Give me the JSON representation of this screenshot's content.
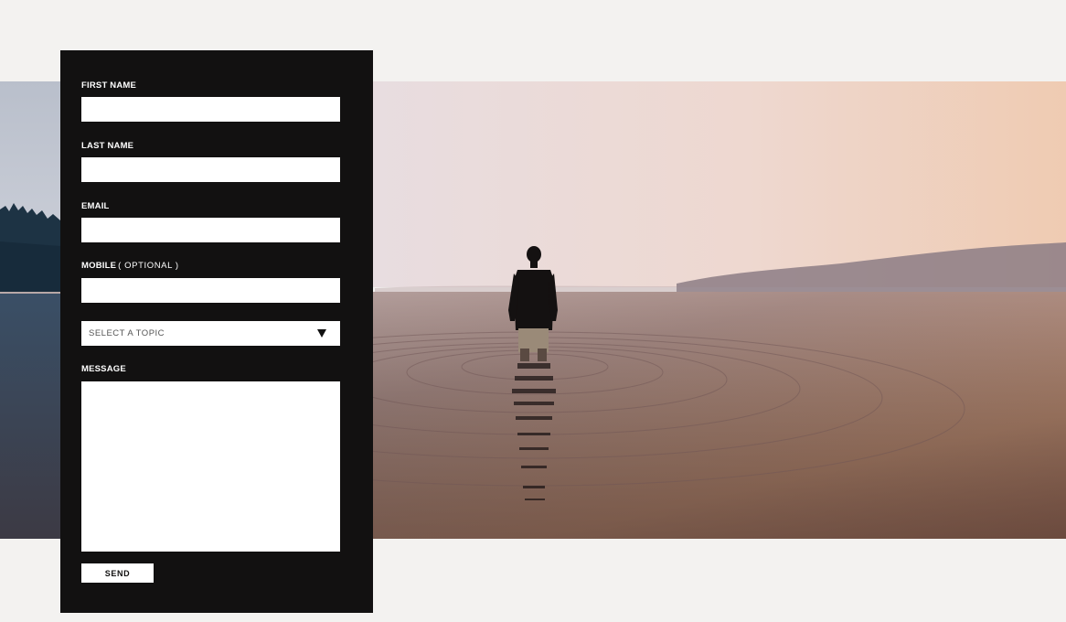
{
  "hero": {
    "image_icon": "person-wading-lake-photo"
  },
  "form": {
    "first_name": {
      "label": "FIRST NAME",
      "value": ""
    },
    "last_name": {
      "label": "LAST NAME",
      "value": ""
    },
    "email": {
      "label": "EMAIL",
      "value": ""
    },
    "mobile": {
      "label": "MOBILE",
      "note": "( OPTIONAL )",
      "value": ""
    },
    "topic": {
      "selected": "SELECT A TOPIC",
      "arrow_icon": "triangle-down-icon"
    },
    "message": {
      "label": "MESSAGE",
      "value": ""
    },
    "send_label": "SEND"
  },
  "colors": {
    "page_background": "#f3f2f0",
    "panel_background": "#121111",
    "input_background": "#ffffff"
  }
}
